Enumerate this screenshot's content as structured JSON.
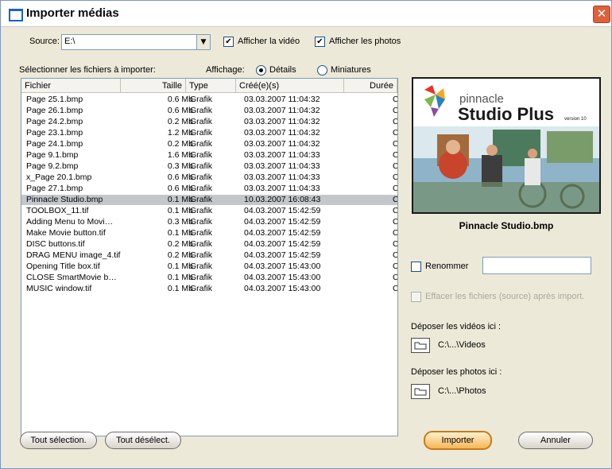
{
  "window": {
    "title": "Importer médias",
    "close_glyph": "✕"
  },
  "source": {
    "label": "Source:",
    "value": "E:\\",
    "dropdown_glyph": "▼"
  },
  "options": {
    "show_video_label": "Afficher la vidéo",
    "show_video_checked": true,
    "show_photos_label": "Afficher les photos",
    "show_photos_checked": true
  },
  "list": {
    "select_label": "Sélectionner les fichiers à importer:",
    "display_label": "Affichage:",
    "view_details_label": "Détails",
    "view_thumbs_label": "Miniatures",
    "columns": {
      "name": "Fichier",
      "size": "Taille",
      "type": "Type",
      "created": "Créé(e)(s)",
      "duration": "Durée"
    },
    "rows": [
      {
        "name": "Page 25.1.bmp",
        "size": "0.6 Mb",
        "type": "Grafik",
        "created": "03.03.2007 11:04:32",
        "duration": "C"
      },
      {
        "name": "Page 26.1.bmp",
        "size": "0.6 Mb",
        "type": "Grafik",
        "created": "03.03.2007 11:04:32",
        "duration": "C"
      },
      {
        "name": "Page 24.2.bmp",
        "size": "0.2 Mb",
        "type": "Grafik",
        "created": "03.03.2007 11:04:32",
        "duration": "C"
      },
      {
        "name": "Page 23.1.bmp",
        "size": "1.2 Mb",
        "type": "Grafik",
        "created": "03.03.2007 11:04:32",
        "duration": "C"
      },
      {
        "name": "Page 24.1.bmp",
        "size": "0.2 Mb",
        "type": "Grafik",
        "created": "03.03.2007 11:04:32",
        "duration": "C"
      },
      {
        "name": "Page 9.1.bmp",
        "size": "1.6 Mb",
        "type": "Grafik",
        "created": "03.03.2007 11:04:33",
        "duration": "C"
      },
      {
        "name": "Page 9.2.bmp",
        "size": "0.3 Mb",
        "type": "Grafik",
        "created": "03.03.2007 11:04:33",
        "duration": "C"
      },
      {
        "name": "x_Page 20.1.bmp",
        "size": "0.6 Mb",
        "type": "Grafik",
        "created": "03.03.2007 11:04:33",
        "duration": "C"
      },
      {
        "name": "Page 27.1.bmp",
        "size": "0.6 Mb",
        "type": "Grafik",
        "created": "03.03.2007 11:04:33",
        "duration": "C"
      },
      {
        "name": "Pinnacle Studio.bmp",
        "size": "0.1 Mb",
        "type": "Grafik",
        "created": "10.03.2007 16:08:43",
        "duration": "C",
        "selected": true
      },
      {
        "name": "TOOLBOX_11.tif",
        "size": "0.1 Mb",
        "type": "Grafik",
        "created": "04.03.2007 15:42:59",
        "duration": "C"
      },
      {
        "name": "Adding Menu to Movi…",
        "size": "0.3 Mb",
        "type": "Grafik",
        "created": "04.03.2007 15:42:59",
        "duration": "C"
      },
      {
        "name": "Make Movie button.tif",
        "size": "0.1 Mb",
        "type": "Grafik",
        "created": "04.03.2007 15:42:59",
        "duration": "C"
      },
      {
        "name": "DISC buttons.tif",
        "size": "0.2 Mb",
        "type": "Grafik",
        "created": "04.03.2007 15:42:59",
        "duration": "C"
      },
      {
        "name": "DRAG MENU image_4.tif",
        "size": "0.2 Mb",
        "type": "Grafik",
        "created": "04.03.2007 15:42:59",
        "duration": "C"
      },
      {
        "name": "Opening Title box.tif",
        "size": "0.1 Mb",
        "type": "Grafik",
        "created": "04.03.2007 15:43:00",
        "duration": "C"
      },
      {
        "name": "CLOSE SmartMovie b…",
        "size": "0.1 Mb",
        "type": "Grafik",
        "created": "04.03.2007 15:43:00",
        "duration": "C"
      },
      {
        "name": "MUSIC window.tif",
        "size": "0.1 Mb",
        "type": "Grafik",
        "created": "04.03.2007 15:43:00",
        "duration": "C"
      }
    ]
  },
  "preview": {
    "brand_small": "pinnacle",
    "brand_big": "Studio Plus",
    "brand_version": "version 10",
    "caption": "Pinnacle Studio.bmp"
  },
  "rename": {
    "label": "Renommer",
    "checked": false,
    "value": ""
  },
  "delete_source": {
    "label": "Effacer les fichiers (source) après import.",
    "checked": false
  },
  "videos_dest": {
    "label": "Déposer les vidéos ici :",
    "path": "C:\\...\\Videos"
  },
  "photos_dest": {
    "label": "Déposer les photos ici :",
    "path": "C:\\...\\Photos"
  },
  "buttons": {
    "select_all": "Tout sélection.",
    "deselect_all": "Tout désélect.",
    "import": "Importer",
    "cancel": "Annuler"
  },
  "colors": {
    "selected_row": "#c3c7cc",
    "import_button": "#f5b755",
    "title_accent": "#1d5fce",
    "close_button": "#e0603a"
  }
}
